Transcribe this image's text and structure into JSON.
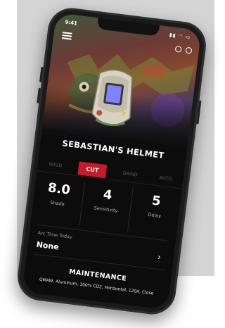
{
  "status_bar": {
    "time": "9:41",
    "icons": "▮▮ ◠ ▭"
  },
  "helmet": {
    "name": "SEBASTIAN'S HELMET"
  },
  "tabs": [
    {
      "label": "WELD",
      "active": false
    },
    {
      "label": "CUT",
      "active": true
    },
    {
      "label": "GRIND",
      "active": false
    },
    {
      "label": "AUTO",
      "active": false
    }
  ],
  "metrics": [
    {
      "value": "8.0",
      "label": "Shade"
    },
    {
      "value": "4",
      "label": "Sensitivity"
    },
    {
      "value": "5",
      "label": "Delay"
    }
  ],
  "arc_time": {
    "label": "Arc Time Today",
    "value": "None"
  },
  "maintenance": {
    "title": "MAINTENANCE",
    "detail": "GMAW, Aluminum, 100% CO2, Horizontal, 120A, Close"
  },
  "colors": {
    "accent": "#c71b2a",
    "background": "#0c0c0c"
  }
}
